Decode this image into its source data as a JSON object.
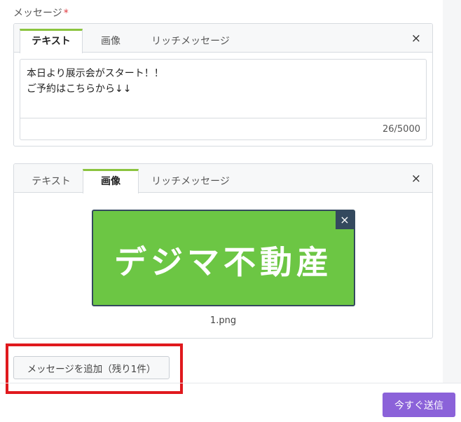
{
  "field": {
    "label": "メッセージ",
    "required_mark": "*"
  },
  "message_cards": [
    {
      "tabs": [
        {
          "label": "テキスト",
          "active": true
        },
        {
          "label": "画像",
          "active": false
        },
        {
          "label": "リッチメッセージ",
          "active": false
        }
      ],
      "close_icon": "×",
      "text_value": "本日より展示会がスタート！！\nご予約はこちらから↓↓",
      "char_count": "26/5000"
    },
    {
      "tabs": [
        {
          "label": "テキスト",
          "active": false
        },
        {
          "label": "画像",
          "active": true
        },
        {
          "label": "リッチメッセージ",
          "active": false
        }
      ],
      "close_icon": "×",
      "image": {
        "text": "デジマ不動産",
        "background": "#6cc644",
        "remove_icon": "×",
        "filename": "1.png"
      }
    }
  ],
  "add_message_button": "メッセージを追加（残り1件）",
  "send_now_button": "今すぐ送信",
  "colors": {
    "accent_tab": "#8bc43f",
    "send_button": "#8b62d9",
    "highlight": "#e0191d",
    "image_bg": "#6cc644",
    "image_border": "#34495e"
  }
}
